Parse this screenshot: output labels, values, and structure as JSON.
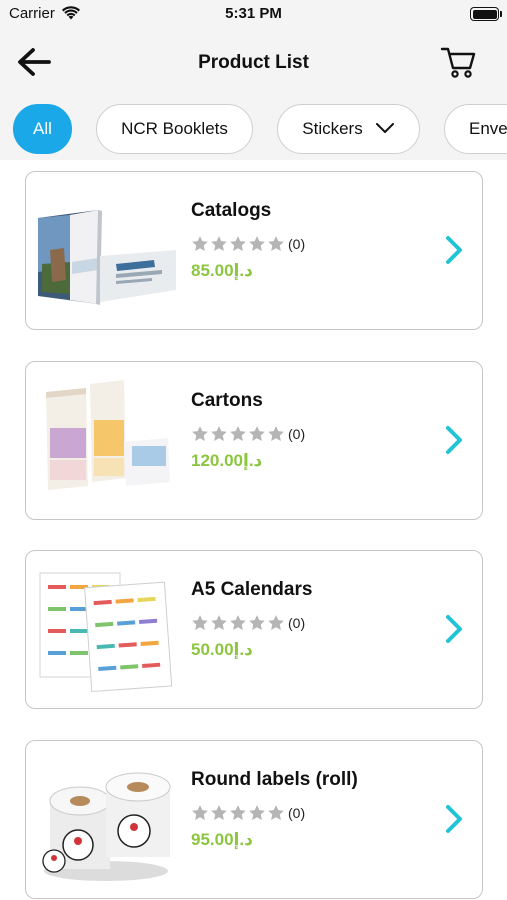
{
  "status_bar": {
    "carrier": "Carrier",
    "time": "5:31 PM",
    "battery_level": 1.0
  },
  "nav": {
    "title": "Product List",
    "back_icon": "arrow-left-icon",
    "cart_icon": "cart-icon"
  },
  "chips": [
    {
      "label": "All",
      "active": true
    },
    {
      "label": "NCR Booklets",
      "active": false
    },
    {
      "label": "Stickers",
      "active": false,
      "has_dropdown": true
    },
    {
      "label": "Envel",
      "active": false
    }
  ],
  "products": [
    {
      "name": "Catalogs",
      "rating": 0,
      "reviews": "(0)",
      "price": "85.00د.إ",
      "image": "catalog-brochures"
    },
    {
      "name": "Cartons",
      "rating": 0,
      "reviews": "(0)",
      "price": "120.00د.إ",
      "image": "carton-boxes"
    },
    {
      "name": "A5 Calendars",
      "rating": 0,
      "reviews": "(0)",
      "price": "50.00د.إ",
      "image": "calendar-sheets"
    },
    {
      "name": "Round labels (roll)",
      "rating": 0,
      "reviews": "(0)",
      "price": "95.00د.إ",
      "image": "label-rolls"
    }
  ],
  "colors": {
    "accent": "#1aa8e8",
    "price": "#8cc63f",
    "chevron": "#20c4d4",
    "star_empty": "#b5b5b5"
  }
}
